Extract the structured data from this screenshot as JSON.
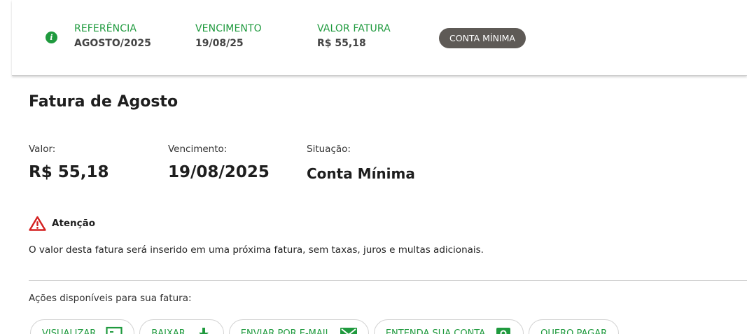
{
  "summary": {
    "reference_label": "REFERÊNCIA",
    "reference_value": "AGOSTO/2025",
    "due_label": "VENCIMENTO",
    "due_value": "19/08/25",
    "amount_label": "VALOR FATURA",
    "amount_value": "R$ 55,18",
    "status_badge": "CONTA MÍNIMA",
    "info_icon": "info-icon"
  },
  "invoice": {
    "title": "Fatura de Agosto",
    "amount_label": "Valor:",
    "amount_value": "R$ 55,18",
    "due_label": "Vencimento:",
    "due_value": "19/08/2025",
    "status_label": "Situação:",
    "status_value": "Conta Mínima"
  },
  "warning": {
    "icon": "warning-triangle-icon",
    "title": "Atenção",
    "text": "O valor desta fatura será inserido em uma próxima fatura, sem taxas, juros e multas adicionais."
  },
  "actions": {
    "label": "Ações disponíveis para sua fatura:",
    "buttons": [
      {
        "label": "VISUALIZAR",
        "icon": "screen-icon"
      },
      {
        "label": "BAIXAR",
        "icon": "download-icon"
      },
      {
        "label": "ENVIAR POR E-MAIL",
        "icon": "email-icon"
      },
      {
        "label": "ENTENDA SUA CONTA",
        "icon": "document-icon"
      },
      {
        "label": "QUERO PAGAR",
        "icon": ""
      }
    ]
  },
  "colors": {
    "accent_green": "#1f9a3e",
    "badge_gray": "#5e5a56",
    "warning_red": "#d42020"
  }
}
